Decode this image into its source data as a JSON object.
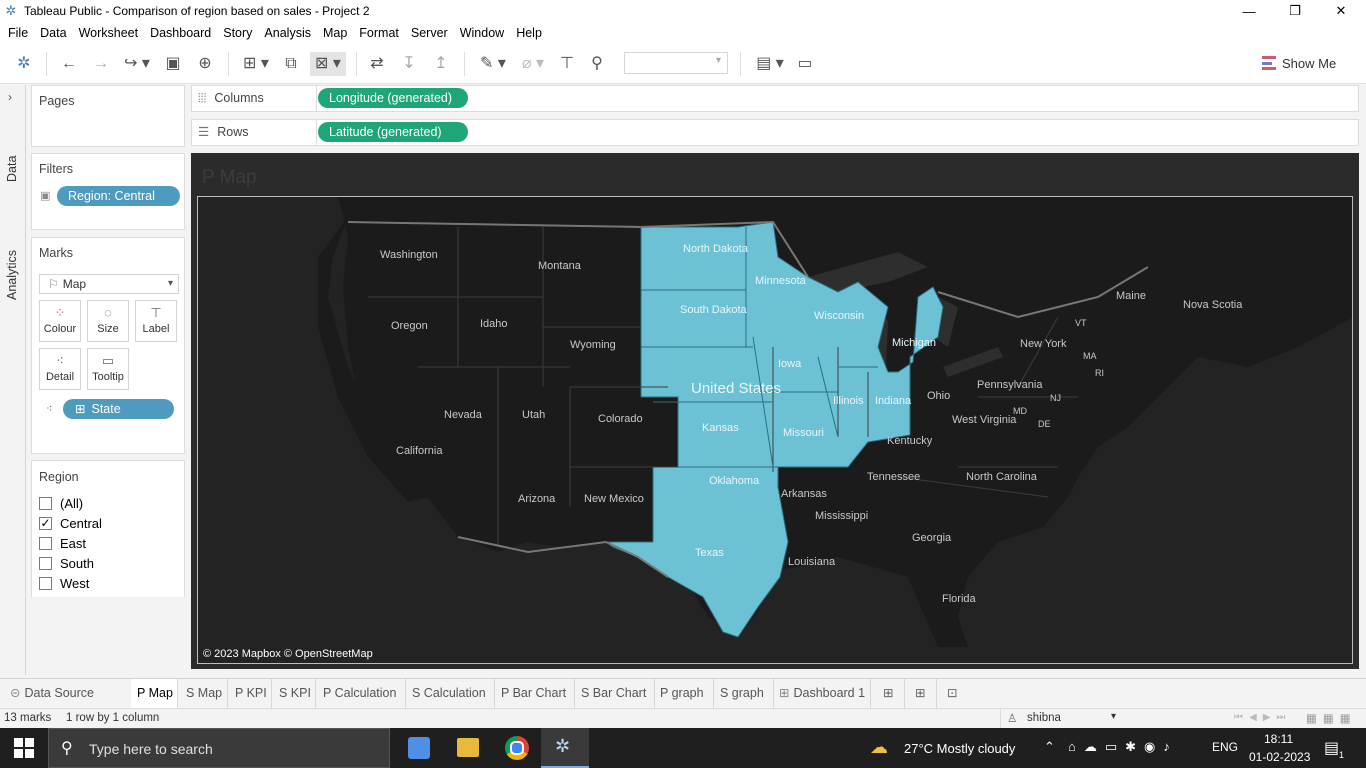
{
  "window": {
    "title": "Tableau Public - Comparison of region based on sales - Project 2"
  },
  "menu": [
    "File",
    "Data",
    "Worksheet",
    "Dashboard",
    "Story",
    "Analysis",
    "Map",
    "Format",
    "Server",
    "Window",
    "Help"
  ],
  "toolbar": {
    "show_me": "Show Me"
  },
  "side_tabs": {
    "data": "Data",
    "analytics": "Analytics"
  },
  "pages": {
    "title": "Pages"
  },
  "filters": {
    "title": "Filters",
    "pill": "Region: Central"
  },
  "marks": {
    "title": "Marks",
    "type": "Map",
    "buttons": [
      "Colour",
      "Size",
      "Label",
      "Detail",
      "Tooltip"
    ],
    "state_pill": "State"
  },
  "region_filter": {
    "title": "Region",
    "items": [
      {
        "label": "(All)",
        "checked": false
      },
      {
        "label": "Central",
        "checked": true
      },
      {
        "label": "East",
        "checked": false
      },
      {
        "label": "South",
        "checked": false
      },
      {
        "label": "West",
        "checked": false
      }
    ]
  },
  "shelves": {
    "columns_label": "Columns",
    "columns_pill": "Longitude (generated)",
    "rows_label": "Rows",
    "rows_pill": "Latitude (generated)"
  },
  "viz": {
    "title": "P Map",
    "attribution": "© 2023 Mapbox © OpenStreetMap",
    "highlight_color": "#6cc2d4",
    "base_land_color": "#1b1b1b",
    "highlighted_states": [
      "North Dakota",
      "South Dakota",
      "Nebraska",
      "Kansas",
      "Oklahoma",
      "Texas",
      "Minnesota",
      "Iowa",
      "Missouri",
      "Wisconsin",
      "Illinois",
      "Indiana",
      "Michigan"
    ],
    "country_label": "United States",
    "state_labels": [
      "Washington",
      "Montana",
      "Oregon",
      "Idaho",
      "Wyoming",
      "Nevada",
      "Utah",
      "Colorado",
      "California",
      "Arizona",
      "New Mexico",
      "North Dakota",
      "South Dakota",
      "Minnesota",
      "Wisconsin",
      "Michigan",
      "Iowa",
      "Illinois",
      "Indiana",
      "Kansas",
      "Missouri",
      "Oklahoma",
      "Texas",
      "Arkansas",
      "Louisiana",
      "Mississippi",
      "Tennessee",
      "Kentucky",
      "Ohio",
      "West Virginia",
      "Pennsylvania",
      "New York",
      "North Carolina",
      "Georgia",
      "Florida",
      "Maine",
      "VT",
      "MA",
      "RI",
      "MD",
      "NJ",
      "DE",
      "Nova Scotia"
    ]
  },
  "sheet_tabs": [
    "Data Source",
    "P Map",
    "S Map",
    "P KPI",
    "S KPI",
    "P Calculation",
    "S Calculation",
    "P Bar Chart",
    "S Bar Chart",
    "P graph",
    "S graph",
    "Dashboard 1"
  ],
  "active_tab": "P Map",
  "status": {
    "marks": "13 marks",
    "layout": "1 row by 1 column",
    "user": "shibna"
  },
  "taskbar": {
    "search_placeholder": "Type here to search",
    "weather": "27°C  Mostly cloudy",
    "lang": "ENG",
    "time": "18:11",
    "date": "01-02-2023",
    "notification_count": "1"
  }
}
